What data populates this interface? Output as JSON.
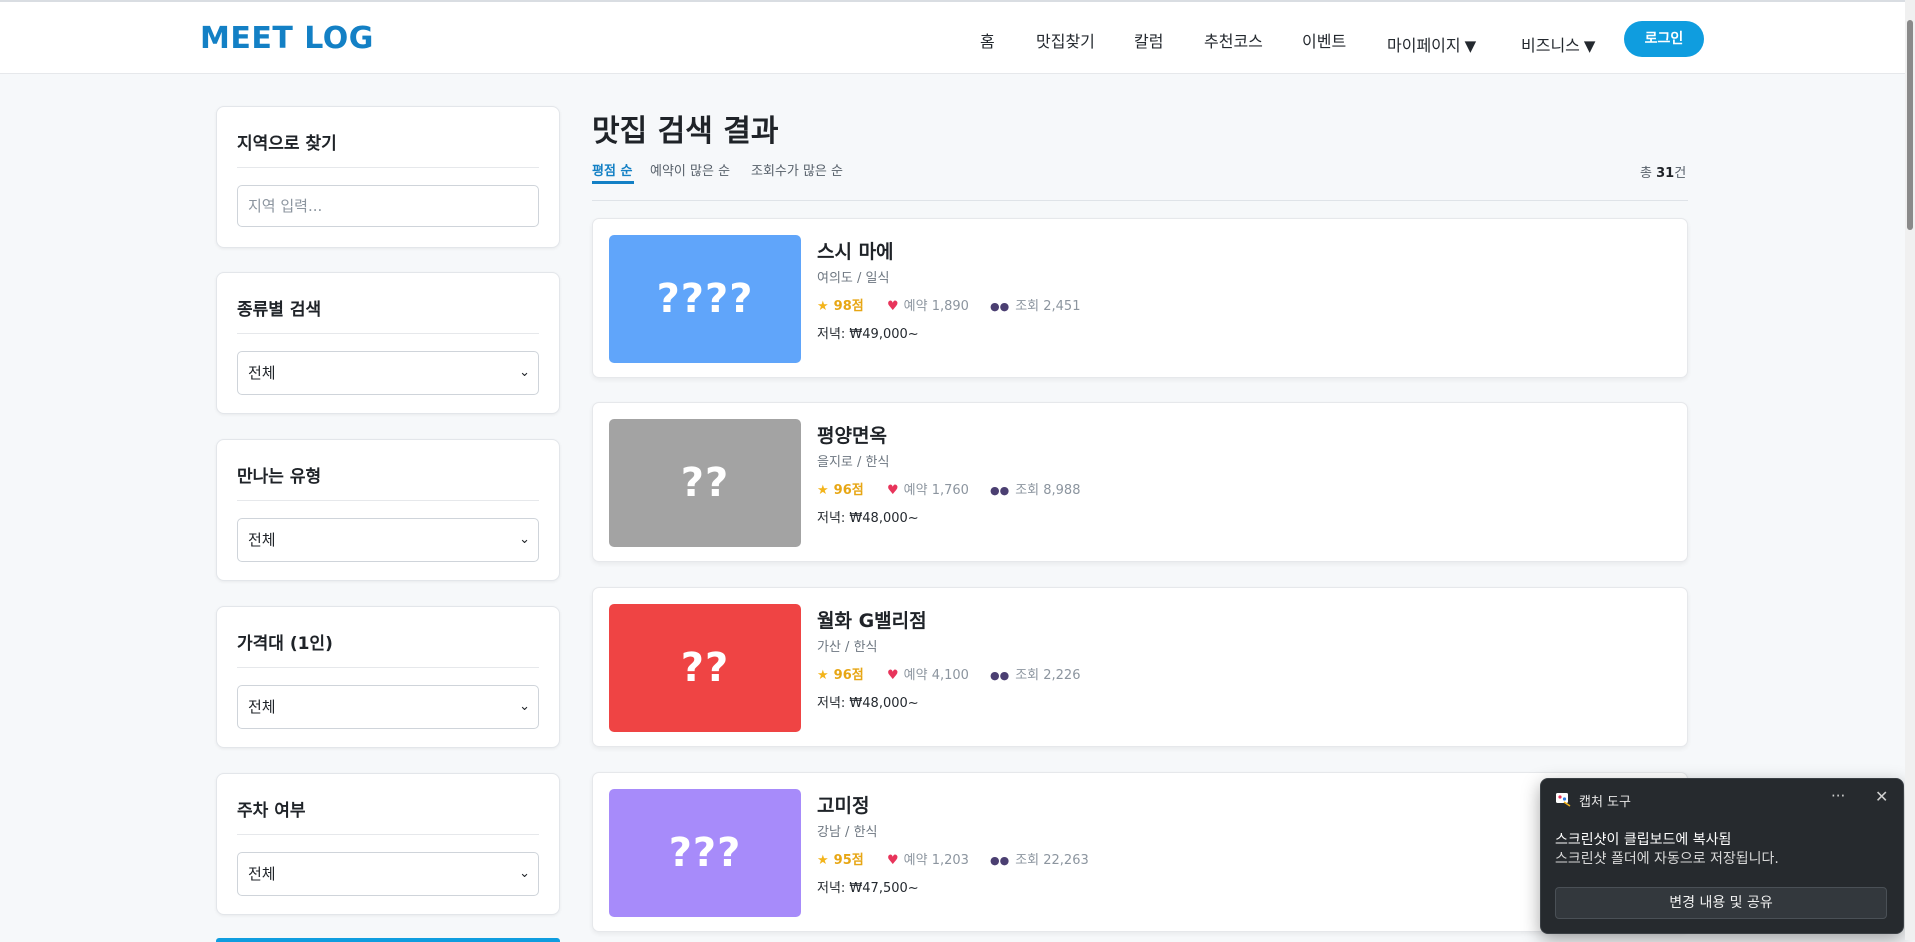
{
  "header": {
    "logo": "MEET LOG",
    "nav": [
      {
        "label": "홈",
        "dropdown": false
      },
      {
        "label": "맛집찾기",
        "dropdown": false
      },
      {
        "label": "칼럼",
        "dropdown": false
      },
      {
        "label": "추천코스",
        "dropdown": false
      },
      {
        "label": "이벤트",
        "dropdown": false
      },
      {
        "label": "마이페이지",
        "dropdown": true
      },
      {
        "label": "비즈니스",
        "dropdown": true
      }
    ],
    "dropdown_caret": "▼",
    "login_label": "로그인"
  },
  "sidebar": {
    "region": {
      "title": "지역으로 찾기",
      "placeholder": "지역 입력..."
    },
    "filters": [
      {
        "title": "종류별 검색",
        "selected": "전체"
      },
      {
        "title": "만나는 유형",
        "selected": "전체"
      },
      {
        "title": "가격대 (1인)",
        "selected": "전체"
      },
      {
        "title": "주차 여부",
        "selected": "전체"
      }
    ]
  },
  "main": {
    "title": "맛집 검색 결과",
    "sort_tabs": [
      "평점 순",
      "예약이 많은 순",
      "조회수가 많은 순"
    ],
    "active_sort": "평점 순",
    "total_prefix": "총 ",
    "total_count": "31",
    "total_suffix": "건",
    "restaurants": [
      {
        "thumb_text": "????",
        "thumb_color": "#60a5fa",
        "name": "스시 마에",
        "location": "여의도 / 일식",
        "score": "98점",
        "reservations": "예약 1,890",
        "views": "조회 2,451",
        "price": "저녁: ₩49,000~"
      },
      {
        "thumb_text": "??",
        "thumb_color": "#a3a3a3",
        "name": "평양면옥",
        "location": "을지로 / 한식",
        "score": "96점",
        "reservations": "예약 1,760",
        "views": "조회 8,988",
        "price": "저녁: ₩48,000~"
      },
      {
        "thumb_text": "??",
        "thumb_color": "#ef4444",
        "name": "월화 G밸리점",
        "location": "가산 / 한식",
        "score": "96점",
        "reservations": "예약 4,100",
        "views": "조회 2,226",
        "price": "저녁: ₩48,000~"
      },
      {
        "thumb_text": "???",
        "thumb_color": "#a78bfa",
        "name": "고미정",
        "location": "강남 / 한식",
        "score": "95점",
        "reservations": "예약 1,203",
        "views": "조회 22,263",
        "price": "저녁: ₩47,500~"
      }
    ]
  },
  "toast": {
    "app_name": "캡처 도구",
    "more_icon": "···",
    "line1": "스크린샷이 클립보드에 복사됨",
    "line2": "스크린샷 폴더에 자동으로 저장됩니다.",
    "button": "변경 내용 및 공유"
  },
  "colors": {
    "brand": "#1380c5",
    "login": "#0f9ddf",
    "score": "#e7a614"
  }
}
